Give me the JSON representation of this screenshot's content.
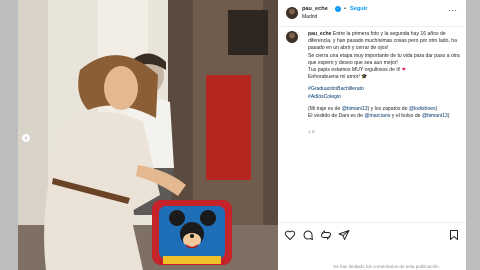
{
  "post": {
    "username": "pau_eche",
    "separator": "•",
    "follow_label": "Seguir",
    "location": "Madrid",
    "more_label": "···"
  },
  "caption": {
    "username": "pau_eche",
    "p1": "Entre la primera foto y la segunda hay 16 años de diferencia, y han pasado muchísimas cosas pero por otro lado, ha pasado en un abrir y cerrar de ojos!",
    "p2": "Se cierra una etapa muy importante de tu vida para dar paso a otra que espero y deseo que sea aun mejor!",
    "p3": "Tus papis estamos MUY orgullosos de ti!",
    "p3_emoji": "❤",
    "p4": "Enhorabuena mi amor!",
    "p4_emoji": "🎓",
    "hashtag1": "#GraduaciónBachillerato",
    "hashtag2": "#AdiósColegio",
    "c1_a": "(Mi traje es de ",
    "c1_tag1": "@bimani13",
    "c1_b": ") y los zapatos de ",
    "c1_tag2": "@lodishoes",
    "c1_c": ")",
    "c2_a": "El vestido de Dani es de ",
    "c2_tag1": "@marciano",
    "c2_b": " y el bolso de ",
    "c2_tag2": "@bimani13",
    "c2_c": ")"
  },
  "time_ago": "1 d",
  "footer": "Se han limitado los comentarios de esta publicación.",
  "icons": [
    "heart-icon",
    "comment-icon",
    "share-icon",
    "send-icon",
    "bookmark-icon",
    "verified-icon",
    "chevron-left-icon",
    "chevron-right-icon"
  ],
  "colors": {
    "link": "#00376b",
    "follow": "#0095f6",
    "text": "#262626",
    "muted": "#8e8e8e"
  }
}
